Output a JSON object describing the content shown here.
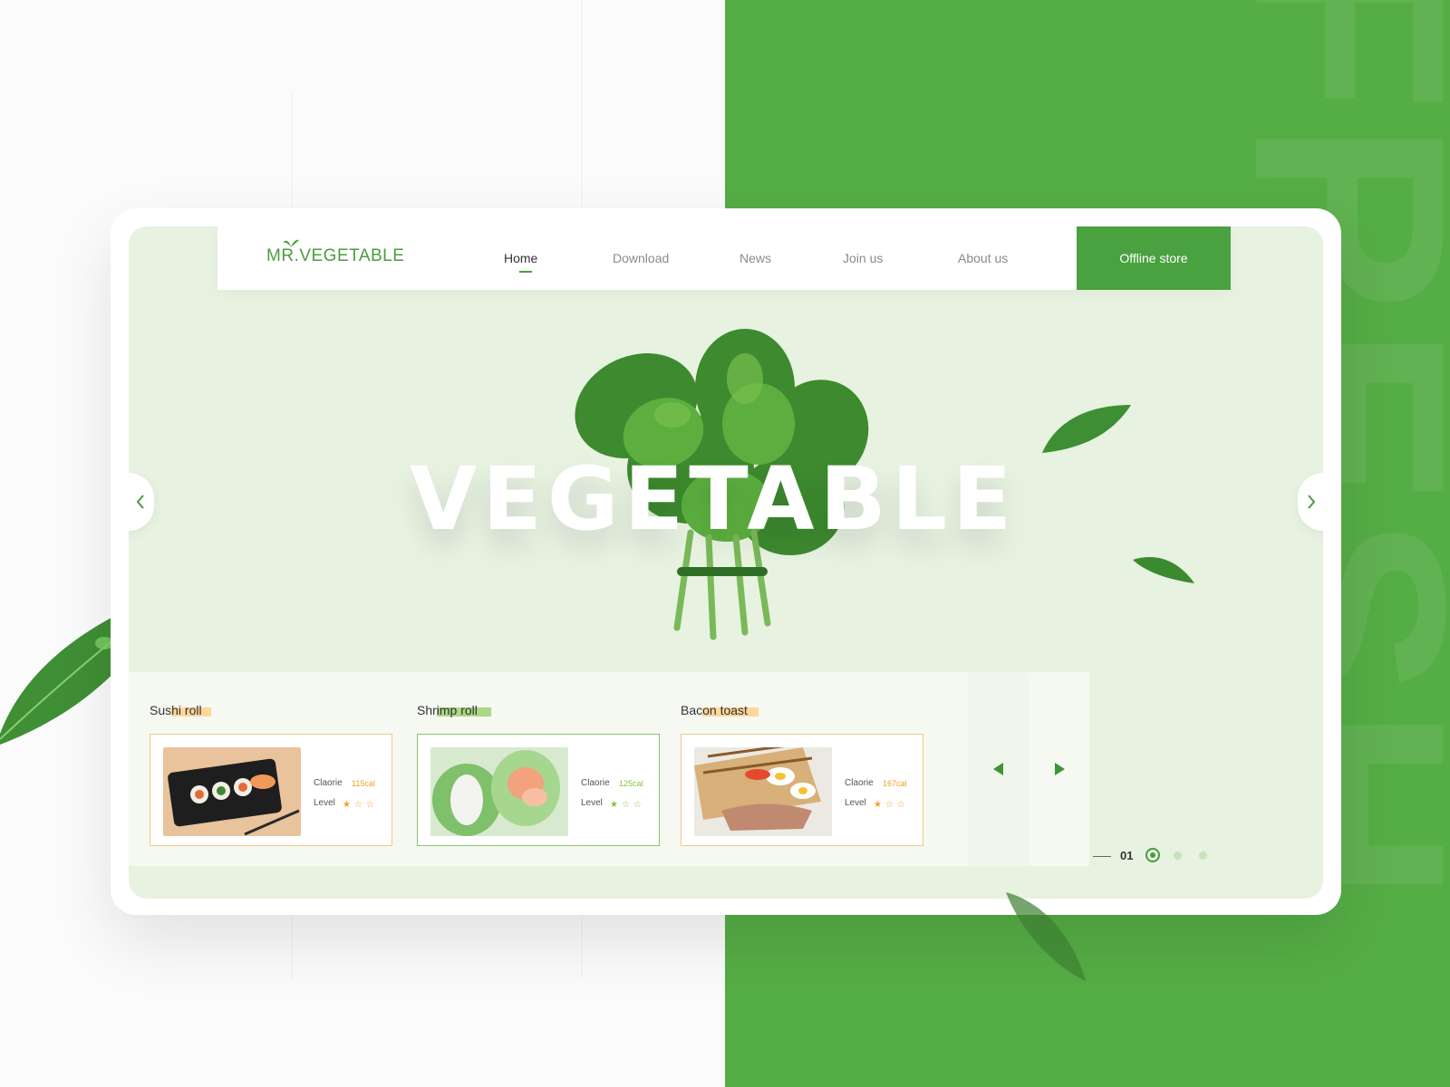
{
  "brand": {
    "logo_text": "MR.VEGETABLE",
    "accent": "#4aa13f",
    "right_panel": "#55ad45"
  },
  "background": {
    "watermark_letters": "FRESH"
  },
  "nav": {
    "items": [
      {
        "label": "Home",
        "active": true
      },
      {
        "label": "Download"
      },
      {
        "label": "News"
      },
      {
        "label": "Join us"
      },
      {
        "label": "About us"
      }
    ],
    "cta_label": "Offline store"
  },
  "hero": {
    "headline": "VEGETABLE",
    "prev_icon": "chevron-left-icon",
    "next_icon": "chevron-right-icon"
  },
  "cards": [
    {
      "title": "Sushi roll",
      "calorie_label": "Claorie",
      "calorie_value": "115cal",
      "level_label": "Level",
      "level": 1,
      "border": "#f0c98b",
      "highlight": "#ffd79b",
      "cal_color": "#f0a020"
    },
    {
      "title": "Shrimp roll",
      "calorie_label": "Claorie",
      "calorie_value": "125cal",
      "level_label": "Level",
      "level": 1,
      "border": "#8cc06a",
      "highlight": "#a9d886",
      "cal_color": "#8cc040"
    },
    {
      "title": "Bacon toast",
      "calorie_label": "Claorie",
      "calorie_value": "167cal",
      "level_label": "Level",
      "level": 1,
      "border": "#f0c98b",
      "highlight": "#ffd79b",
      "cal_color": "#f0a020"
    }
  ],
  "strip_nav": {
    "prev_icon": "triangle-left-icon",
    "next_icon": "triangle-right-icon"
  },
  "pager": {
    "current": "01",
    "total_dots": 3,
    "active_index": 0
  }
}
